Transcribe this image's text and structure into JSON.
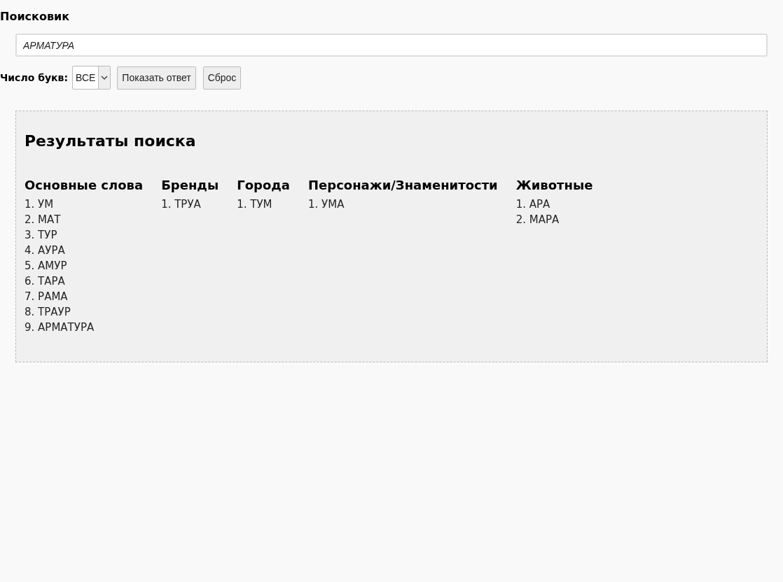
{
  "title": "Поисковик",
  "search": {
    "value": "АРМАТУРА"
  },
  "letters": {
    "label": "Число букв:",
    "value": "ВСЕ"
  },
  "buttons": [
    "Показать ответ",
    "Сброс"
  ],
  "results": {
    "heading": "Результаты поиска",
    "columns": [
      {
        "heading": "Основные слова",
        "items": [
          "1. УМ",
          "2. МАТ",
          "3. ТУР",
          "4. АУРА",
          "5. АМУР",
          "6. ТАРА",
          "7. РАМА",
          "8. ТРАУР",
          "9. АРМАТУРА"
        ]
      },
      {
        "heading": "Бренды",
        "items": [
          "1. ТРУА"
        ]
      },
      {
        "heading": "Города",
        "items": [
          "1. ТУМ"
        ]
      },
      {
        "heading": "Персонажи/Знаменитости",
        "items": [
          "1. УМА"
        ]
      },
      {
        "heading": "Животные",
        "items": [
          "1. АРА",
          "2. МАРА"
        ]
      }
    ]
  }
}
